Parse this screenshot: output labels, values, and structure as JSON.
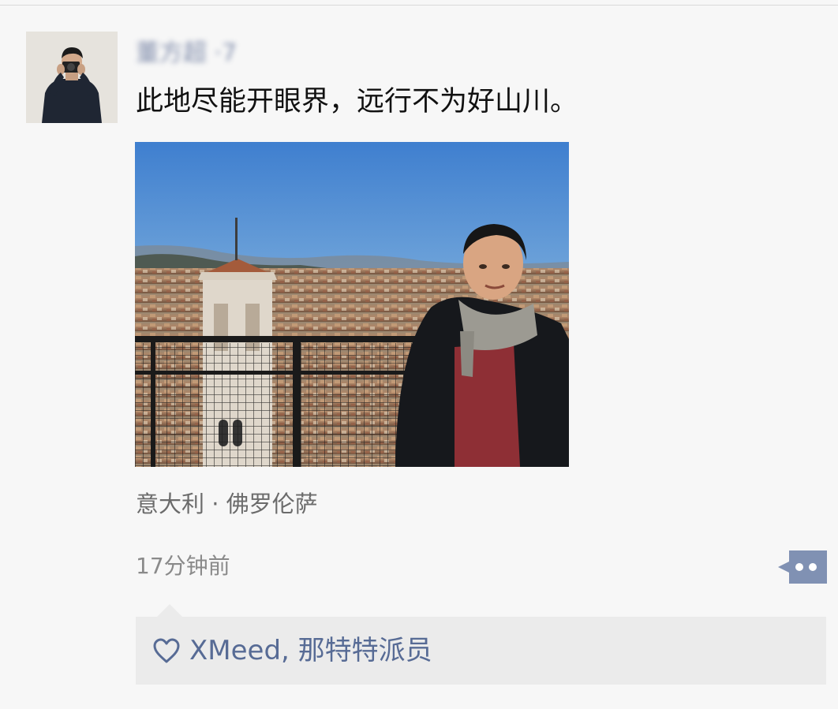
{
  "post": {
    "username": "董方超 ·7",
    "text": "此地尽能开眼界，远行不为好山川。",
    "location": "意大利 · 佛罗伦萨",
    "time": "17分钟前"
  },
  "likes": {
    "names": "XMeed, 那特特派员"
  },
  "icons": {
    "like": "heart-outline-icon",
    "more": "more-comment-icon"
  },
  "colors": {
    "background": "#f7f7f7",
    "link_blue": "#576b95",
    "likes_bg": "#ebebeb",
    "more_button": "#8091b3"
  }
}
